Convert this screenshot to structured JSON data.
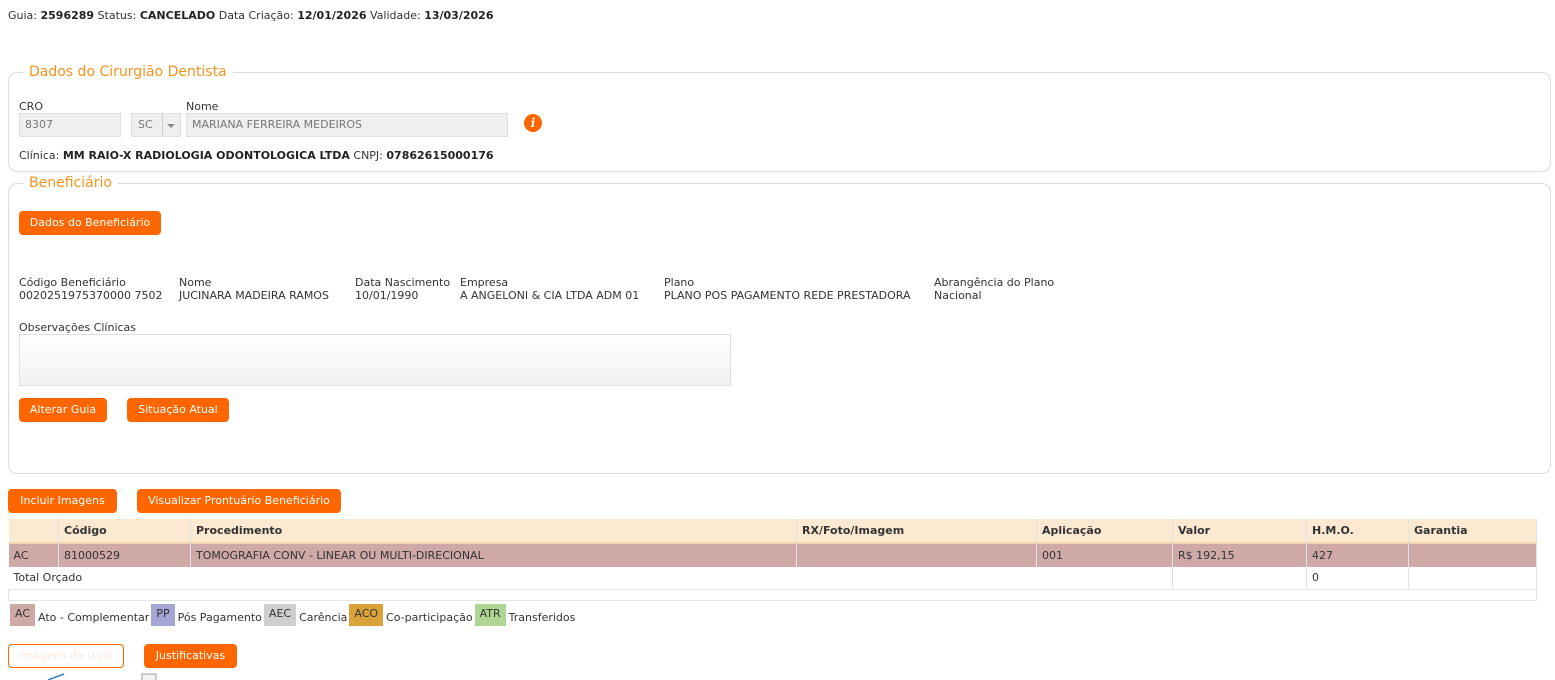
{
  "header": {
    "guia_label": "Guia:",
    "guia_value": "2596289",
    "status_label": "Status:",
    "status_value": "CANCELADO",
    "created_label": "Data Criação:",
    "created_value": "12/01/2026",
    "validity_label": "Validade:",
    "validity_value": "13/03/2026"
  },
  "dentist": {
    "legend": "Dados do Cirurgião Dentista",
    "cro_label": "CRO",
    "cro_value": "8307",
    "uf_value": "SC",
    "name_label": "Nome",
    "name_value": "MARIANA FERREIRA MEDEIROS",
    "clinic_label": "Clínica:",
    "clinic_value": "MM RAIO-X RADIOLOGIA ODONTOLOGICA LTDA",
    "cnpj_label": "CNPJ:",
    "cnpj_value": "07862615000176",
    "info_icon": "i"
  },
  "beneficiary": {
    "legend": "Beneficiário",
    "data_button": "Dados do Beneficiário",
    "fields": [
      {
        "label": "Código Beneficiário",
        "value": "0020251975370000 7502"
      },
      {
        "label": "Nome",
        "value": "JUCINARA MADEIRA RAMOS"
      },
      {
        "label": "Data Nascimento",
        "value": "10/01/1990"
      },
      {
        "label": "Empresa",
        "value": "A ANGELONI & CIA LTDA ADM 01"
      },
      {
        "label": "Plano",
        "value": "PLANO POS PAGAMENTO REDE PRESTADORA"
      },
      {
        "label": "Abrangência do Plano",
        "value": "Nacional"
      }
    ],
    "obs_label": "Observações Clínicas",
    "obs_value": "",
    "alter_button": "Alterar Guia",
    "situation_button": "Situação Atual"
  },
  "actions": {
    "include_images": "Incluir Imagens",
    "view_record": "Visualizar Prontuário Beneficiário"
  },
  "table": {
    "headers": [
      "",
      "Código",
      "Procedimento",
      "RX/Foto/Imagem",
      "Aplicação",
      "Valor",
      "H.M.O.",
      "Garantia"
    ],
    "rows": [
      {
        "type": "AC",
        "code": "81000529",
        "procedure": "TOMOGRAFIA CONV - LINEAR OU MULTI-DIRECIONAL",
        "rx": "",
        "application": "001",
        "value": "R$ 192,15",
        "hmo": "427",
        "warranty": ""
      }
    ],
    "total_label": "Total Orçado",
    "total_value": "",
    "total_hmo": "0"
  },
  "legend_items": [
    {
      "code": "AC",
      "label": "Ato - Complementar",
      "color": "#cfa8a8"
    },
    {
      "code": "PP",
      "label": "Pós Pagamento",
      "color": "#a6a6d6"
    },
    {
      "code": "AEC",
      "label": "Carência",
      "color": "#cfcfcf"
    },
    {
      "code": "ACO",
      "label": "Co-participação",
      "color": "#d9a33a"
    },
    {
      "code": "ATR",
      "label": "Transferidos",
      "color": "#aed693"
    }
  ],
  "bottom": {
    "images_button": "Imagens da Guia",
    "justifications_button": "Justificativas"
  }
}
